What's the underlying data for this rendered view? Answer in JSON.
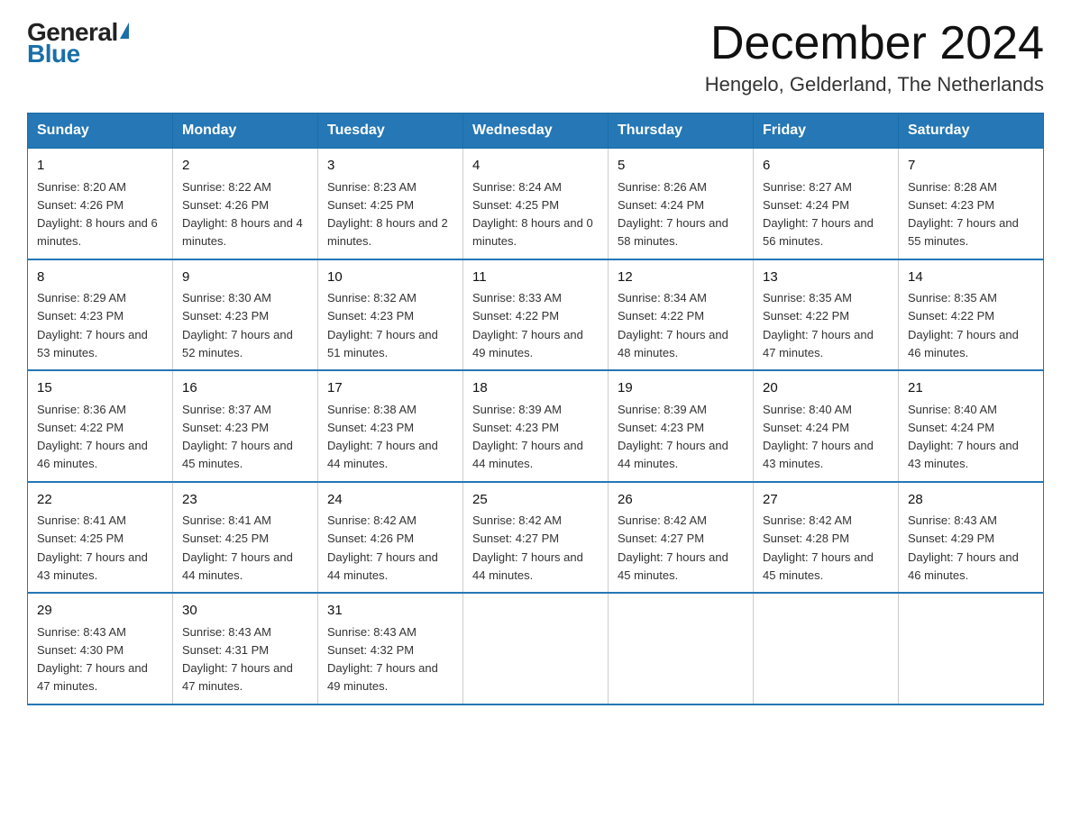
{
  "header": {
    "logo_general": "General",
    "logo_blue": "Blue",
    "month_year": "December 2024",
    "location": "Hengelo, Gelderland, The Netherlands"
  },
  "days_of_week": [
    "Sunday",
    "Monday",
    "Tuesday",
    "Wednesday",
    "Thursday",
    "Friday",
    "Saturday"
  ],
  "weeks": [
    [
      {
        "day": "1",
        "sunrise": "8:20 AM",
        "sunset": "4:26 PM",
        "daylight": "8 hours and 6 minutes."
      },
      {
        "day": "2",
        "sunrise": "8:22 AM",
        "sunset": "4:26 PM",
        "daylight": "8 hours and 4 minutes."
      },
      {
        "day": "3",
        "sunrise": "8:23 AM",
        "sunset": "4:25 PM",
        "daylight": "8 hours and 2 minutes."
      },
      {
        "day": "4",
        "sunrise": "8:24 AM",
        "sunset": "4:25 PM",
        "daylight": "8 hours and 0 minutes."
      },
      {
        "day": "5",
        "sunrise": "8:26 AM",
        "sunset": "4:24 PM",
        "daylight": "7 hours and 58 minutes."
      },
      {
        "day": "6",
        "sunrise": "8:27 AM",
        "sunset": "4:24 PM",
        "daylight": "7 hours and 56 minutes."
      },
      {
        "day": "7",
        "sunrise": "8:28 AM",
        "sunset": "4:23 PM",
        "daylight": "7 hours and 55 minutes."
      }
    ],
    [
      {
        "day": "8",
        "sunrise": "8:29 AM",
        "sunset": "4:23 PM",
        "daylight": "7 hours and 53 minutes."
      },
      {
        "day": "9",
        "sunrise": "8:30 AM",
        "sunset": "4:23 PM",
        "daylight": "7 hours and 52 minutes."
      },
      {
        "day": "10",
        "sunrise": "8:32 AM",
        "sunset": "4:23 PM",
        "daylight": "7 hours and 51 minutes."
      },
      {
        "day": "11",
        "sunrise": "8:33 AM",
        "sunset": "4:22 PM",
        "daylight": "7 hours and 49 minutes."
      },
      {
        "day": "12",
        "sunrise": "8:34 AM",
        "sunset": "4:22 PM",
        "daylight": "7 hours and 48 minutes."
      },
      {
        "day": "13",
        "sunrise": "8:35 AM",
        "sunset": "4:22 PM",
        "daylight": "7 hours and 47 minutes."
      },
      {
        "day": "14",
        "sunrise": "8:35 AM",
        "sunset": "4:22 PM",
        "daylight": "7 hours and 46 minutes."
      }
    ],
    [
      {
        "day": "15",
        "sunrise": "8:36 AM",
        "sunset": "4:22 PM",
        "daylight": "7 hours and 46 minutes."
      },
      {
        "day": "16",
        "sunrise": "8:37 AM",
        "sunset": "4:23 PM",
        "daylight": "7 hours and 45 minutes."
      },
      {
        "day": "17",
        "sunrise": "8:38 AM",
        "sunset": "4:23 PM",
        "daylight": "7 hours and 44 minutes."
      },
      {
        "day": "18",
        "sunrise": "8:39 AM",
        "sunset": "4:23 PM",
        "daylight": "7 hours and 44 minutes."
      },
      {
        "day": "19",
        "sunrise": "8:39 AM",
        "sunset": "4:23 PM",
        "daylight": "7 hours and 44 minutes."
      },
      {
        "day": "20",
        "sunrise": "8:40 AM",
        "sunset": "4:24 PM",
        "daylight": "7 hours and 43 minutes."
      },
      {
        "day": "21",
        "sunrise": "8:40 AM",
        "sunset": "4:24 PM",
        "daylight": "7 hours and 43 minutes."
      }
    ],
    [
      {
        "day": "22",
        "sunrise": "8:41 AM",
        "sunset": "4:25 PM",
        "daylight": "7 hours and 43 minutes."
      },
      {
        "day": "23",
        "sunrise": "8:41 AM",
        "sunset": "4:25 PM",
        "daylight": "7 hours and 44 minutes."
      },
      {
        "day": "24",
        "sunrise": "8:42 AM",
        "sunset": "4:26 PM",
        "daylight": "7 hours and 44 minutes."
      },
      {
        "day": "25",
        "sunrise": "8:42 AM",
        "sunset": "4:27 PM",
        "daylight": "7 hours and 44 minutes."
      },
      {
        "day": "26",
        "sunrise": "8:42 AM",
        "sunset": "4:27 PM",
        "daylight": "7 hours and 45 minutes."
      },
      {
        "day": "27",
        "sunrise": "8:42 AM",
        "sunset": "4:28 PM",
        "daylight": "7 hours and 45 minutes."
      },
      {
        "day": "28",
        "sunrise": "8:43 AM",
        "sunset": "4:29 PM",
        "daylight": "7 hours and 46 minutes."
      }
    ],
    [
      {
        "day": "29",
        "sunrise": "8:43 AM",
        "sunset": "4:30 PM",
        "daylight": "7 hours and 47 minutes."
      },
      {
        "day": "30",
        "sunrise": "8:43 AM",
        "sunset": "4:31 PM",
        "daylight": "7 hours and 47 minutes."
      },
      {
        "day": "31",
        "sunrise": "8:43 AM",
        "sunset": "4:32 PM",
        "daylight": "7 hours and 49 minutes."
      },
      null,
      null,
      null,
      null
    ]
  ]
}
